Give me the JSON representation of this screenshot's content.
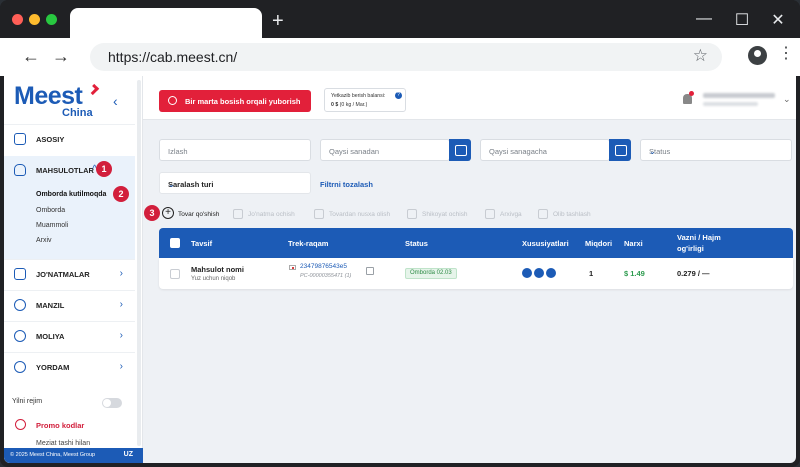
{
  "browser": {
    "url": "https://cab.meest.cn/",
    "new_tab": "+",
    "win_min": "—",
    "win_max": "☐",
    "win_close": "✕",
    "back": "←",
    "forward": "→",
    "star": "☆",
    "menu": "⋮"
  },
  "sidebar": {
    "logo": "Meest",
    "logo_sub": "China",
    "collapse": "‹",
    "items": [
      {
        "label": "ASOSIY"
      },
      {
        "label": "MAHSULOTLAR"
      },
      {
        "label": "JO'NATMALAR"
      },
      {
        "label": "MANZIL"
      },
      {
        "label": "MOLIYA"
      },
      {
        "label": "YORDAM"
      }
    ],
    "subitems": [
      "Omborda kutilmoqda",
      "Omborda",
      "Muammoli",
      "Arxiv"
    ],
    "dark_mode": "Yilni rejim",
    "promo": "Promo kodlar",
    "cut_item": "Meziat tashi hilan",
    "footer": "© 2025 Meest China, Meest Group",
    "lang": "UZ"
  },
  "badges": [
    "1",
    "2",
    "3"
  ],
  "header": {
    "send_button": "Bir marta bosish orqali yuborish",
    "balance_label": "Yetkazib berish balansi:",
    "balance_value": "0 $",
    "balance_unit": "(0 kg / Mar.)",
    "help": "?"
  },
  "filters": {
    "search_placeholder": "Izlash",
    "date_from": "Qaysi sanadan",
    "date_to": "Qaysi sanagacha",
    "status": "Status",
    "sort": "Saralash turi",
    "clear": "Filtrni tozalash"
  },
  "actions": [
    {
      "label": "Tovar qo'shish",
      "enabled": true
    },
    {
      "label": "Jo'natma ochish",
      "enabled": false
    },
    {
      "label": "Tovardan nusxa olish",
      "enabled": false
    },
    {
      "label": "Shikoyat ochish",
      "enabled": false
    },
    {
      "label": "Arxivga",
      "enabled": false
    },
    {
      "label": "Olib tashlash",
      "enabled": false
    }
  ],
  "table": {
    "headers": [
      "Tavsif",
      "Trek-raqam",
      "Status",
      "Xususiyatlari",
      "Miqdori",
      "Narxi",
      "Vazni / Hajm",
      "og'irligi"
    ],
    "row": {
      "name": "Mahsulot nomi",
      "desc": "Yuz uchun niqob",
      "track": "23479876543e5",
      "track_sub": "PC-00000355471 (1)",
      "status": "Omborda 02.03",
      "qty": "1",
      "price": "$ 1.49",
      "weight": "0.279 / —"
    }
  },
  "colors": {
    "brand": "#1c5bb6",
    "accent": "#e2203a",
    "success": "#2e9b4f"
  }
}
